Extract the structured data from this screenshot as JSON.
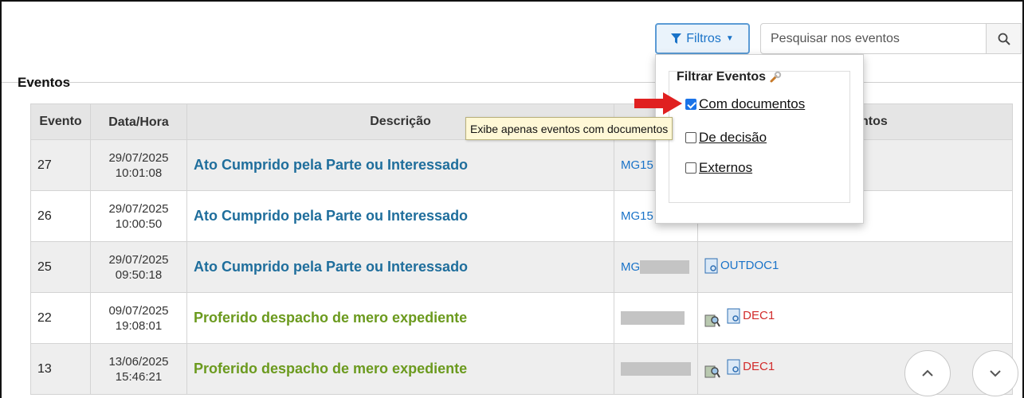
{
  "toolbar": {
    "filter_label": "Filtros",
    "search_placeholder": "Pesquisar nos eventos"
  },
  "section": {
    "title": "Eventos"
  },
  "table": {
    "headers": {
      "evento": "Evento",
      "data_hora": "Data/Hora",
      "descricao": "Descrição",
      "usuario": "",
      "documentos": "ntos"
    },
    "rows": [
      {
        "evento": "27",
        "data": "29/07/2025",
        "hora": "10:01:08",
        "descricao": "Ato Cumprido pela Parte ou Interessado",
        "usuario": "MG15",
        "doc": ""
      },
      {
        "evento": "26",
        "data": "29/07/2025",
        "hora": "10:00:50",
        "descricao": "Ato Cumprido pela Parte ou Interessado",
        "usuario": "MG15",
        "doc": ""
      },
      {
        "evento": "25",
        "data": "29/07/2025",
        "hora": "09:50:18",
        "descricao": "Ato Cumprido pela Parte ou Interessado",
        "usuario": "MG",
        "doc": "OUTDOC1"
      },
      {
        "evento": "22",
        "data": "09/07/2025",
        "hora": "19:08:01",
        "descricao": "Proferido despacho de mero expediente",
        "usuario": "",
        "doc": "DEC1"
      },
      {
        "evento": "13",
        "data": "13/06/2025",
        "hora": "15:46:21",
        "descricao": "Proferido despacho de mero expediente",
        "usuario": "",
        "doc": "DEC1"
      }
    ]
  },
  "filter_menu": {
    "title": "Filtrar Eventos",
    "options": [
      {
        "label": "Com documentos",
        "checked": true
      },
      {
        "label": "De decisão",
        "checked": false
      },
      {
        "label": "Externos",
        "checked": false
      }
    ]
  },
  "tooltip": {
    "text": "Exibe apenas eventos com documentos"
  },
  "colors": {
    "accent": "#1a73c8",
    "desc_blue": "#1f6e9c",
    "desc_green": "#6b9a1e",
    "doc_red": "#d22b2b",
    "arrow_red": "#e02020"
  }
}
